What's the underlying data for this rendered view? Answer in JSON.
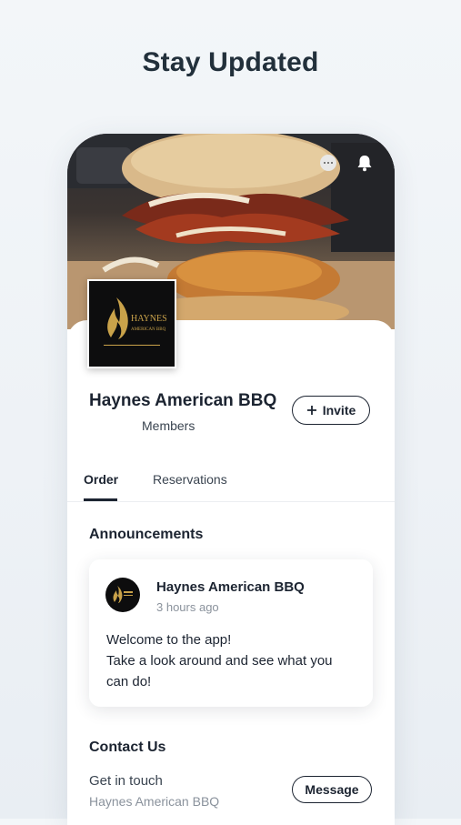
{
  "headline": "Stay Updated",
  "business": {
    "name": "Haynes American BBQ",
    "members_label": "Members",
    "logo_text_line1": "HAYNES",
    "logo_text_line2": "AMERICAN BBQ"
  },
  "actions": {
    "invite_label": "Invite"
  },
  "tabs": [
    {
      "label": "Order",
      "active": true
    },
    {
      "label": "Reservations",
      "active": false
    }
  ],
  "announcements": {
    "title": "Announcements",
    "post": {
      "author": "Haynes American BBQ",
      "time": "3 hours ago",
      "line1": "Welcome to the app!",
      "line2": "Take a look around and see what you",
      "line3": "can do!"
    }
  },
  "contact": {
    "title": "Contact Us",
    "get_in_touch": "Get in touch",
    "business_name": "Haynes American BBQ",
    "message_label": "Message"
  },
  "icons": [
    "chat-icon",
    "bell-icon",
    "plus-icon",
    "flame-logo"
  ],
  "colors": {
    "text": "#1c2431",
    "muted": "#8a929c",
    "logo_gold": "#c9a24a",
    "logo_bg": "#0d0d0e"
  }
}
